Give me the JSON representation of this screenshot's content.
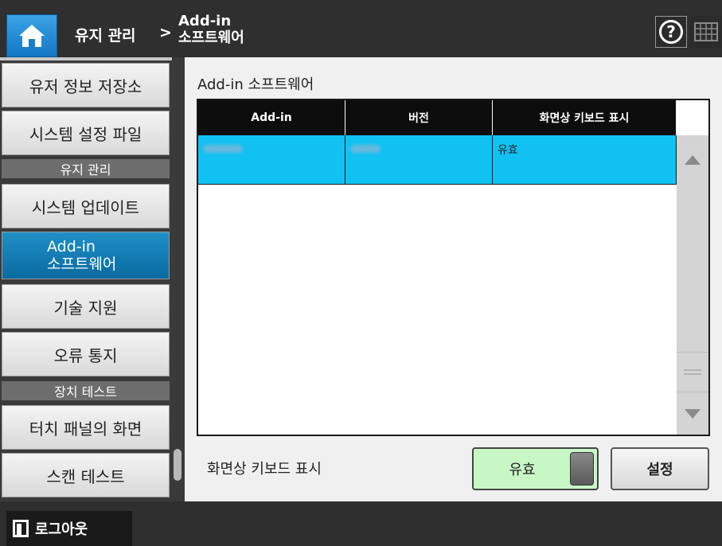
{
  "header": {
    "breadcrumb_parent": "유지 관리",
    "breadcrumb_separator": ">",
    "breadcrumb_current_line1": "Add-in",
    "breadcrumb_current_line2": "소프트웨어",
    "help_label": "?"
  },
  "sidebar": {
    "items": [
      {
        "label": "유저 정보 저장소"
      },
      {
        "label": "시스템 설정 파일"
      },
      {
        "section": "유지 관리"
      },
      {
        "label": "시스템 업데이트"
      },
      {
        "label_line1": "Add-in",
        "label_line2": "소프트웨어",
        "active": true
      },
      {
        "label": "기술 지원"
      },
      {
        "label": "오류 통지"
      },
      {
        "section": "장치 테스트"
      },
      {
        "label": "터치 패널의 화면"
      },
      {
        "label": "스캔 테스트"
      }
    ]
  },
  "main": {
    "title": "Add-in 소프트웨어",
    "table": {
      "columns": [
        "Add-in",
        "버전",
        "화면상 키보드 표시"
      ],
      "rows": [
        {
          "addin": "",
          "version": "",
          "keyboard_display": "유효",
          "selected": true
        }
      ]
    },
    "keyboard_setting_label": "화면상 키보드 표시",
    "toggle_value": "유효",
    "apply_label": "설정"
  },
  "footer": {
    "logout_label": "로그아웃"
  },
  "colors": {
    "header_bg": "#2f2f2f",
    "active_item": "#0a6aa1",
    "selected_row": "#11c1f2",
    "toggle_bg": "#c8f7c6"
  }
}
